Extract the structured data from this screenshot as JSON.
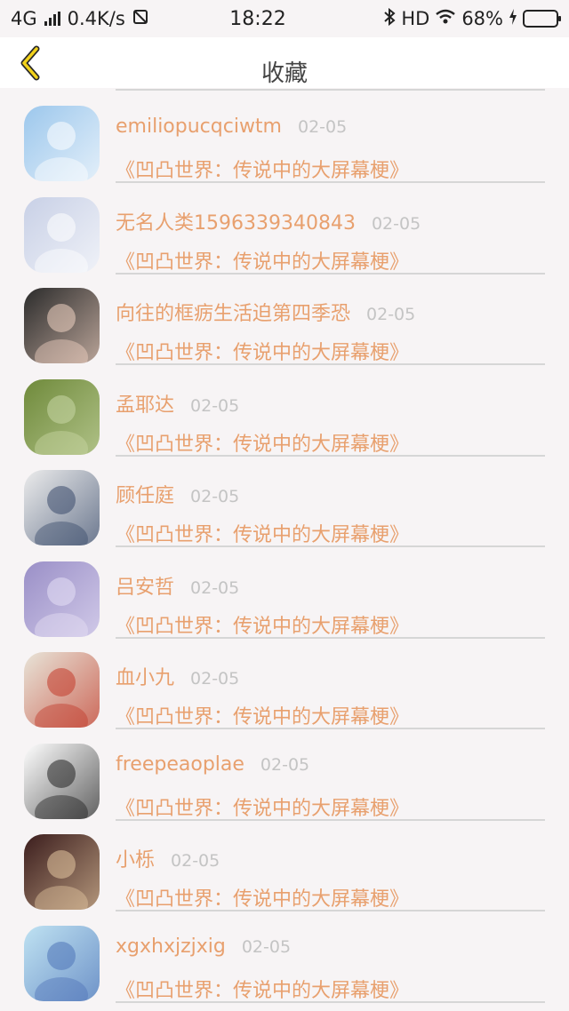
{
  "status_bar": {
    "network": "4G",
    "speed": "0.4K/s",
    "time": "18:22",
    "hd": "HD",
    "battery": "68%",
    "battery_level": 0.68
  },
  "header": {
    "title": "收藏"
  },
  "items": [
    {
      "name": "",
      "date": "",
      "title": "《凹凸世界：传说中的大屏幕梗》"
    },
    {
      "name": "emiliopucqciwtm",
      "date": "02-05",
      "title": "《凹凸世界：传说中的大屏幕梗》"
    },
    {
      "name": "无名人类1596339340843",
      "date": "02-05",
      "title": "《凹凸世界：传说中的大屏幕梗》"
    },
    {
      "name": "向往的框疬生活迫第四季恐",
      "date": "02-05",
      "title": "《凹凸世界：传说中的大屏幕梗》"
    },
    {
      "name": "孟耶达",
      "date": "02-05",
      "title": "《凹凸世界：传说中的大屏幕梗》"
    },
    {
      "name": "顾任庭",
      "date": "02-05",
      "title": "《凹凸世界：传说中的大屏幕梗》"
    },
    {
      "name": "吕安哲",
      "date": "02-05",
      "title": "《凹凸世界：传说中的大屏幕梗》"
    },
    {
      "name": "血小九",
      "date": "02-05",
      "title": "《凹凸世界：传说中的大屏幕梗》"
    },
    {
      "name": "freepeaoplae",
      "date": "02-05",
      "title": "《凹凸世界：传说中的大屏幕梗》"
    },
    {
      "name": "小栎",
      "date": "02-05",
      "title": "《凹凸世界：传说中的大屏幕梗》"
    },
    {
      "name": "xgxhxjzjxig",
      "date": "02-05",
      "title": "《凹凸世界：传说中的大屏幕梗》"
    }
  ]
}
